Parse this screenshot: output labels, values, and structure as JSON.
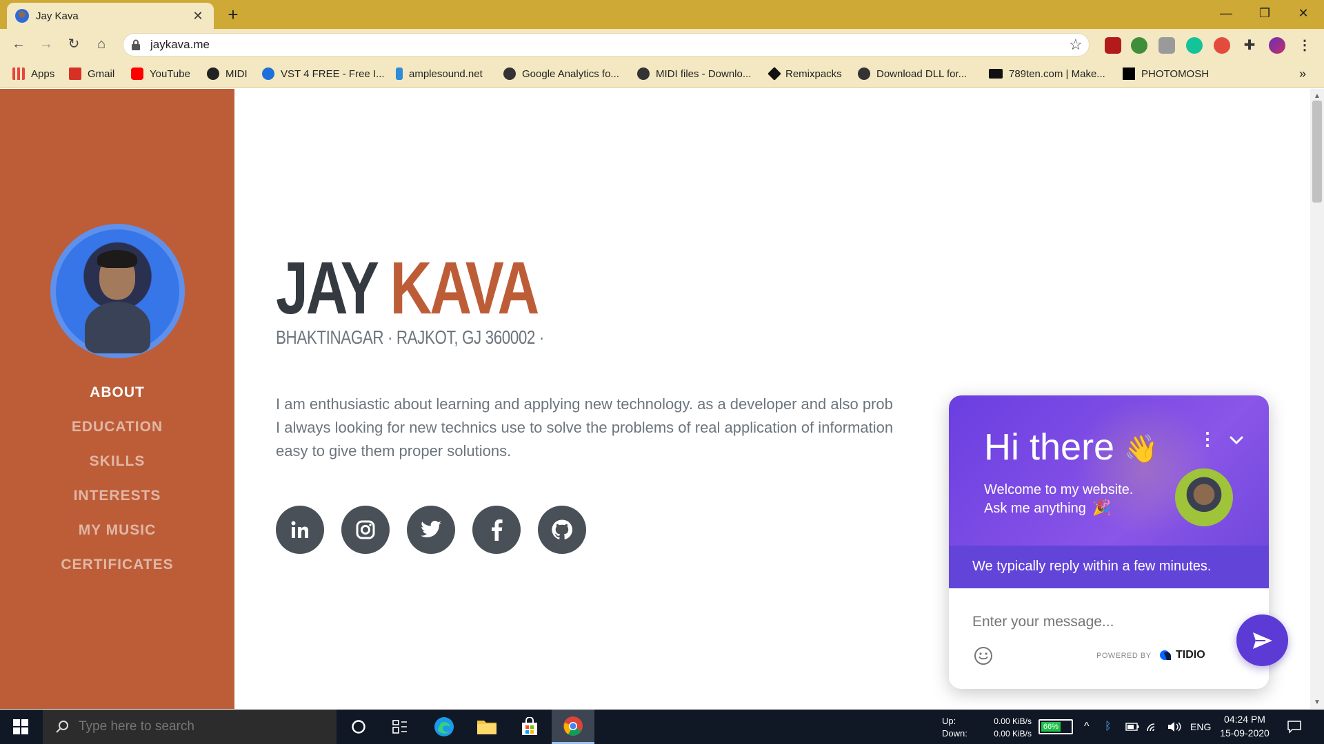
{
  "browser": {
    "tab_title": "Jay Kava",
    "url": "jaykava.me",
    "bookmarks": [
      {
        "label": "Apps",
        "icon": "apps-grid-icon",
        "color": "#e8453c"
      },
      {
        "label": "Gmail",
        "icon": "gmail-icon",
        "color": "#d93025"
      },
      {
        "label": "YouTube",
        "icon": "youtube-icon",
        "color": "#ff0000"
      },
      {
        "label": "MIDI",
        "icon": "midi-icon",
        "color": "#222222"
      },
      {
        "label": "VST 4 FREE - Free I...",
        "icon": "vst-icon",
        "color": "#1e6fd9"
      },
      {
        "label": "amplesound.net",
        "icon": "amplesound-icon",
        "color": "#2e8bd8"
      },
      {
        "label": "Google Analytics fo...",
        "icon": "globe-icon",
        "color": "#333333"
      },
      {
        "label": "MIDI files - Downlo...",
        "icon": "globe-icon",
        "color": "#333333"
      },
      {
        "label": "Remixpacks",
        "icon": "remixpacks-icon",
        "color": "#111111"
      },
      {
        "label": "Download DLL for...",
        "icon": "globe-icon",
        "color": "#333333"
      },
      {
        "label": "789ten.com | Make...",
        "icon": "789ten-icon",
        "color": "#111111"
      },
      {
        "label": "PHOTOMOSH",
        "icon": "photomosh-icon",
        "color": "#000000"
      }
    ],
    "more_bookmarks": "»"
  },
  "page": {
    "first_name": "JAY",
    "last_name": "KAVA",
    "address": "BHAKTINAGAR · RAJKOT, GJ 360002 ·",
    "bio_lines": [
      "I am enthusiastic about learning and applying new technology. as a developer and also prob",
      "I always looking for new technics use to solve the problems of real application of information",
      "easy to give them proper solutions."
    ],
    "nav": [
      {
        "label": "ABOUT",
        "active": true
      },
      {
        "label": "EDUCATION",
        "active": false
      },
      {
        "label": "SKILLS",
        "active": false
      },
      {
        "label": "INTERESTS",
        "active": false
      },
      {
        "label": "MY MUSIC",
        "active": false
      },
      {
        "label": "CERTIFICATES",
        "active": false
      }
    ],
    "social": [
      "linkedin-icon",
      "instagram-icon",
      "twitter-icon",
      "facebook-icon",
      "github-icon"
    ],
    "colors": {
      "primary": "#bd5d38",
      "dark": "#343a40",
      "muted": "#6c757d"
    }
  },
  "chat_widget": {
    "greeting": "Hi there",
    "greeting_emoji": "👋",
    "welcome_line1": "Welcome to my website.",
    "welcome_line2": "Ask me anything",
    "party_emoji": "🎉",
    "reply_time": "We typically reply within a few minutes.",
    "input_placeholder": "Enter your message...",
    "powered_by": "POWERED BY",
    "brand": "TIDIO",
    "accent": "#6a3ee0"
  },
  "taskbar": {
    "search_placeholder": "Type here to search",
    "net_up_label": "Up:",
    "net_down_label": "Down:",
    "net_up_value": "0.00 KiB/s",
    "net_down_value": "0.00 KiB/s",
    "battery_percent": "66%",
    "battery_level": 0.66,
    "language": "ENG",
    "time": "04:24 PM",
    "date": "15-09-2020"
  }
}
